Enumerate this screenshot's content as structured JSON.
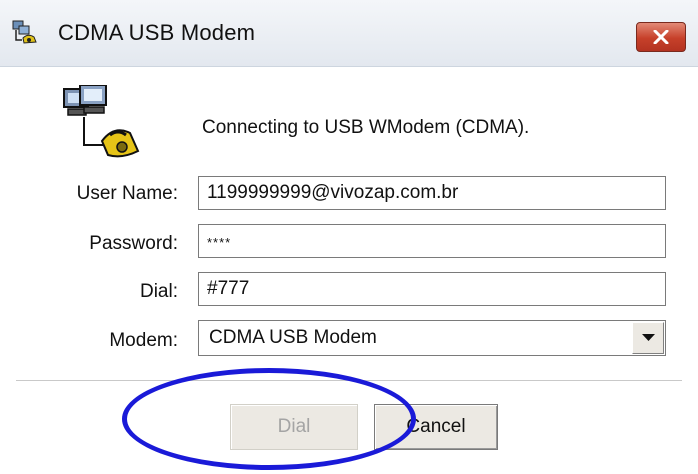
{
  "window": {
    "title": "CDMA USB Modem",
    "close_icon": "close-x-icon",
    "app_icon": "network-phone-icon"
  },
  "status": {
    "icon": "computer-phone-connection-icon",
    "text": "Connecting to USB WModem (CDMA)."
  },
  "form": {
    "username": {
      "label": "User Name:",
      "value": "1199999999@vivozap.com.br"
    },
    "password": {
      "label": "Password:",
      "value": "****"
    },
    "dial": {
      "label": "Dial:",
      "value": "#777"
    },
    "modem": {
      "label": "Modem:",
      "value": "CDMA USB Modem",
      "dropdown_icon": "chevron-down-icon"
    }
  },
  "buttons": {
    "dial_label": "Dial",
    "dial_enabled": false,
    "cancel_label": "Cancel"
  },
  "colors": {
    "annotation_circle": "#1a1ad8",
    "close_button": "#c6402a",
    "disabled_text": "#a4a4a4"
  }
}
